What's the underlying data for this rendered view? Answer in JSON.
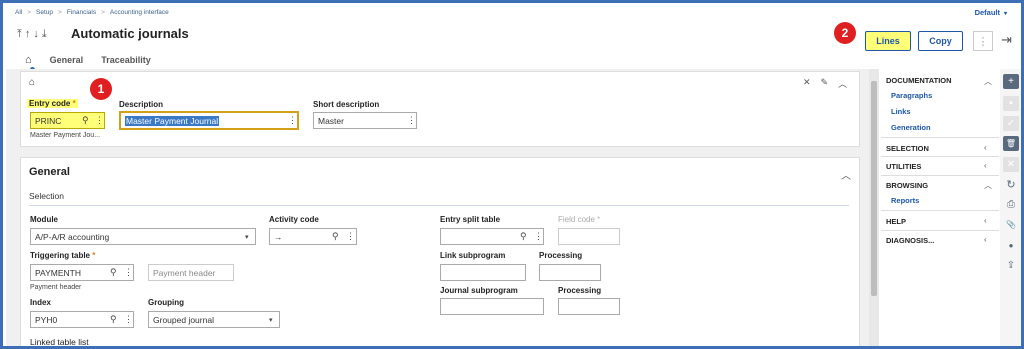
{
  "breadcrumb": [
    "All",
    "Setup",
    "Financials",
    "Accounting interface"
  ],
  "breadcrumb_sep": ">",
  "profile": {
    "label": "Default",
    "chev": "▾"
  },
  "header": {
    "nav_arrows": "⤒↑↓⤓",
    "title": "Automatic journals",
    "lines_button": "Lines",
    "copy_button": "Copy",
    "more_icon": "⋮",
    "exit_icon": "⇥"
  },
  "tabs": {
    "home_icon": "⌂",
    "general": "General",
    "traceability": "Traceability"
  },
  "badges": {
    "one": "1",
    "two": "2"
  },
  "header_card": {
    "home_icon": "⌂",
    "entry_code_label": "Entry code",
    "required_mark": "*",
    "entry_code_value": "PRINC",
    "entry_code_sub": "Master Payment Jou...",
    "description_label": "Description",
    "description_value": "Master Payment Journal",
    "short_description_label": "Short description",
    "short_description_value": "Master",
    "icons": {
      "tools": "✕",
      "edit": "✎",
      "collapse": "︿"
    }
  },
  "general": {
    "title": "General",
    "collapse_icon": "︿",
    "selection_label": "Selection",
    "module_label": "Module",
    "module_value": "A/P-A/R accounting",
    "activity_code_label": "Activity code",
    "activity_code_value": "→",
    "entry_split_table_label": "Entry split table",
    "field_code_label": "Field code",
    "triggering_table_label": "Triggering table",
    "triggering_table_value": "PAYMENTH",
    "triggering_table_sub": "Payment header",
    "triggering_table_desc": "Payment header",
    "link_subprogram_label": "Link subprogram",
    "processing_label": "Processing",
    "index_label": "Index",
    "index_value": "PYH0",
    "grouping_label": "Grouping",
    "grouping_value": "Grouped journal",
    "journal_subprogram_label": "Journal subprogram",
    "processing2_label": "Processing",
    "linked_table_list_label": "Linked table list",
    "icons": {
      "search": "⚲",
      "more": "⋮",
      "dropdown": "▾"
    }
  },
  "sidepanel": {
    "documentation": "DOCUMENTATION",
    "paragraphs": "Paragraphs",
    "links": "Links",
    "generation": "Generation",
    "selection": "SELECTION",
    "utilities": "UTILITIES",
    "browsing": "BROWSING",
    "reports": "Reports",
    "help": "HELP",
    "diagnosis": "DIAGNOSIS...",
    "icons": {
      "expanded": "︿",
      "collapsed": "‹"
    }
  },
  "toolbar": {
    "icons": {
      "add": "+",
      "save": "▪",
      "check": "✓",
      "delete": "🗑",
      "cancel": "✕",
      "refresh": "↻",
      "print": "⎙",
      "attach": "📎",
      "comment": "●",
      "share": "⇪"
    }
  },
  "colors": {
    "accent": "#1d57a5",
    "highlight": "#ffff78",
    "badge": "#e02020",
    "frame": "#3d6fb6"
  }
}
